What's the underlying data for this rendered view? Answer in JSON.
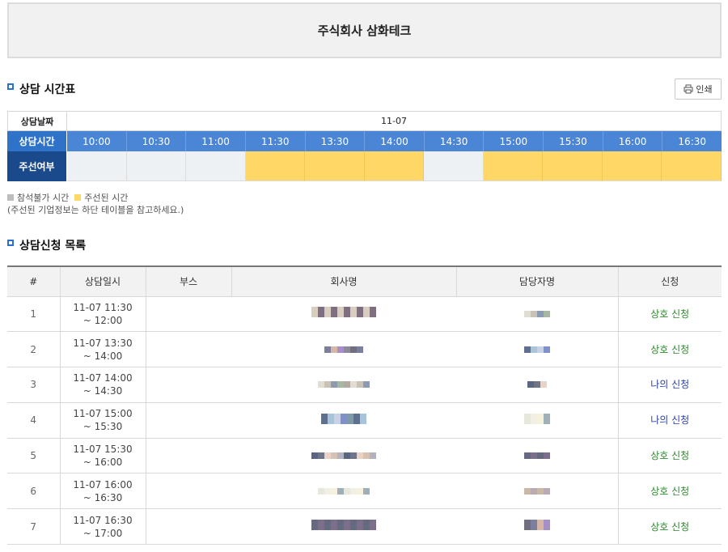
{
  "company": {
    "title": "주식회사 삼화테크"
  },
  "schedule_section": {
    "title": "상담 시간표",
    "print_label": "인쇄",
    "print_icon": "printer-icon"
  },
  "schedule": {
    "date_label": "상담날짜",
    "date_value": "11-07",
    "time_label": "상담시간",
    "status_label": "주선여부",
    "times": [
      "10:00",
      "10:30",
      "11:00",
      "11:30",
      "13:30",
      "14:00",
      "14:30",
      "15:00",
      "15:30",
      "16:00",
      "16:30"
    ],
    "status": [
      "free",
      "free",
      "free",
      "busy",
      "busy",
      "busy",
      "free",
      "busy",
      "busy",
      "busy",
      "busy"
    ]
  },
  "legend": {
    "unavailable": "참석불가 시간",
    "arranged": "주선된 시간",
    "note": "(주선된 기업정보는 하단 테이블을 참고하세요.)",
    "unavailable_color": "#bdbdbd",
    "arranged_color": "#ffd766"
  },
  "list_section": {
    "title": "상담신청 목록"
  },
  "list": {
    "headers": [
      "#",
      "상담일시",
      "부스",
      "회사명",
      "담당자명",
      "신청"
    ],
    "rows": [
      {
        "no": "1",
        "time_start": "11-07 11:30",
        "time_end": "~ 12:00",
        "booth": "",
        "action": "상호 신청",
        "kind": "mutual"
      },
      {
        "no": "2",
        "time_start": "11-07 13:30",
        "time_end": "~ 14:00",
        "booth": "",
        "action": "상호 신청",
        "kind": "mutual"
      },
      {
        "no": "3",
        "time_start": "11-07 14:00",
        "time_end": "~ 14:30",
        "booth": "",
        "action": "나의 신청",
        "kind": "mine"
      },
      {
        "no": "4",
        "time_start": "11-07 15:00",
        "time_end": "~ 15:30",
        "booth": "",
        "action": "나의 신청",
        "kind": "mine"
      },
      {
        "no": "5",
        "time_start": "11-07 15:30",
        "time_end": "~ 16:00",
        "booth": "",
        "action": "상호 신청",
        "kind": "mutual"
      },
      {
        "no": "6",
        "time_start": "11-07 16:00",
        "time_end": "~ 16:30",
        "booth": "",
        "action": "상호 신청",
        "kind": "mutual"
      },
      {
        "no": "7",
        "time_start": "11-07 16:30",
        "time_end": "~ 17:00",
        "booth": "",
        "action": "상호 신청",
        "kind": "mutual"
      }
    ]
  },
  "colors": {
    "accent": "#2e73c8",
    "dark_blue": "#1b4a8c",
    "arranged": "#ffd766",
    "mutual": "#2e8a2e",
    "mine": "#2a3fb0"
  }
}
